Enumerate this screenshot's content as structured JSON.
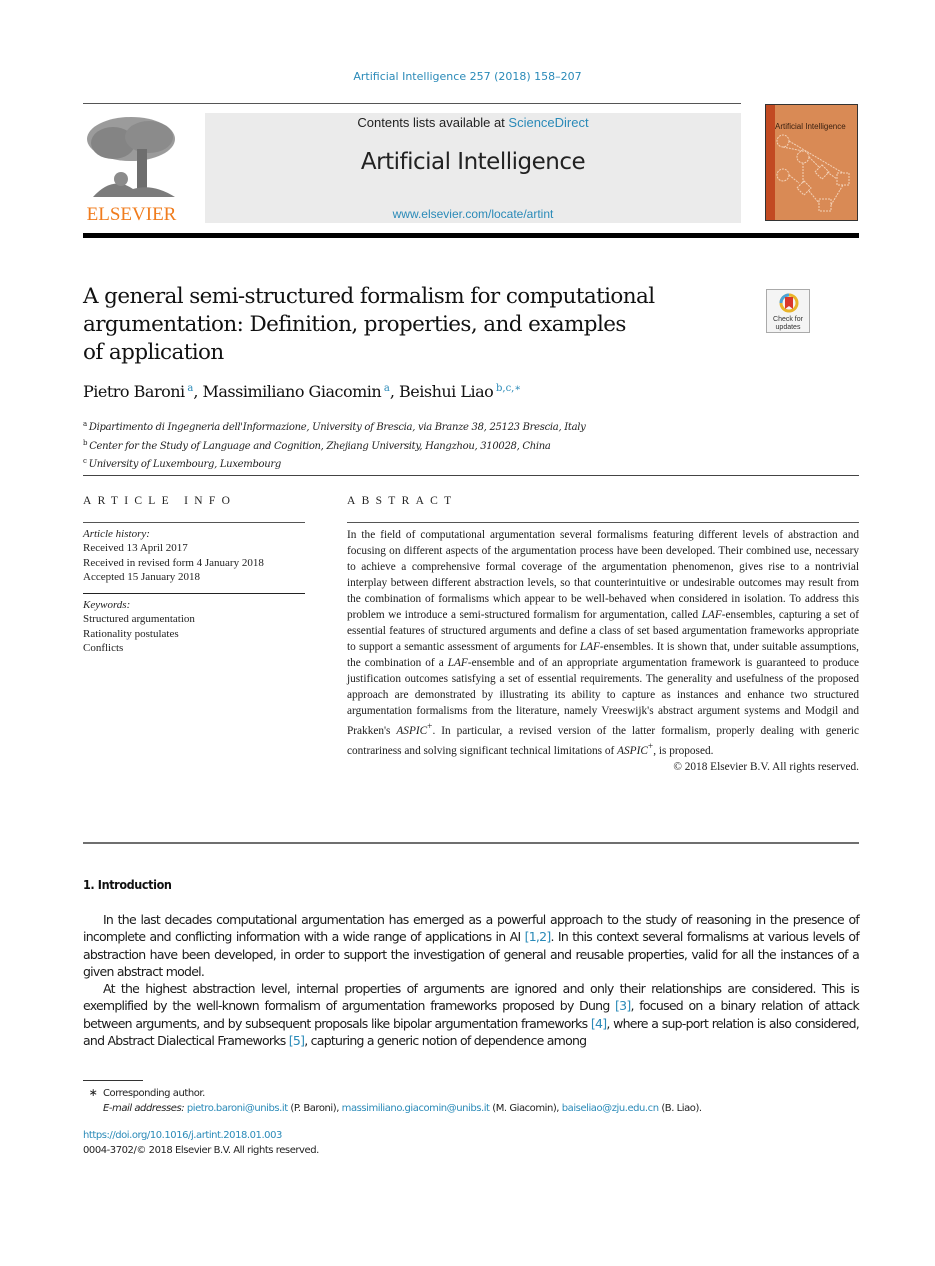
{
  "running_head": "Artificial Intelligence 257 (2018) 158–207",
  "masthead": {
    "publisher": "ELSEVIER",
    "contents_prefix": "Contents lists available at ",
    "contents_link": "ScienceDirect",
    "journal": "Artificial Intelligence",
    "url": "www.elsevier.com/locate/artint",
    "cover_title": "Artificial Intelligence",
    "colors": {
      "link": "#2a8ab8",
      "publisher": "#f07c1d",
      "cover": "#d98a55",
      "cover_strip": "#c24a22"
    }
  },
  "crossmark": {
    "line1": "Check for",
    "line2": "updates"
  },
  "title_lines": [
    "A general semi-structured formalism for computational",
    "argumentation: Definition, properties, and examples",
    "of application"
  ],
  "authors": [
    {
      "name": "Pietro Baroni",
      "sup": "a"
    },
    {
      "name": "Massimiliano Giacomin",
      "sup": "a"
    },
    {
      "name": "Beishui Liao",
      "sup": "b,c,∗"
    }
  ],
  "affiliations": [
    {
      "mark": "a",
      "text": "Dipartimento di Ingegneria dell'Informazione, University of Brescia, via Branze 38, 25123 Brescia, Italy"
    },
    {
      "mark": "b",
      "text": "Center for the Study of Language and Cognition, Zhejiang University, Hangzhou, 310028, China"
    },
    {
      "mark": "c",
      "text": "University of Luxembourg, Luxembourg"
    }
  ],
  "article_info": {
    "heading": "ARTICLE INFO",
    "history_label": "Article history:",
    "history": [
      "Received 13 April 2017",
      "Received in revised form 4 January 2018",
      "Accepted 15 January 2018"
    ],
    "keywords_label": "Keywords:",
    "keywords": [
      "Structured argumentation",
      "Rationality postulates",
      "Conflicts"
    ]
  },
  "abstract": {
    "heading": "ABSTRACT",
    "p1": "In the field of computational argumentation several formalisms featuring different levels of abstraction and focusing on different aspects of the argumentation process have been developed. Their combined use, necessary to achieve a comprehensive formal coverage of the argumentation phenomenon, gives rise to a nontrivial interplay between different abstraction levels, so that counterintuitive or undesirable outcomes may result from the combination of formalisms which appear to be well-behaved when considered in isolation. To address this problem we introduce a semi-structured formalism for argumentation, called ",
    "laf": "LAF",
    "p2": "-ensembles, capturing a set of essential features of structured arguments and define a class of set based argumentation frameworks appropriate to support a semantic assessment of arguments for ",
    "p3": "-ensembles. It is shown that, under suitable assumptions, the combination of a ",
    "p4": "-ensemble and of an appropriate argumentation framework is guaranteed to produce justification outcomes satisfying a set of essential requirements. The generality and usefulness of the proposed approach are demonstrated by illustrating its ability to capture as instances and enhance two structured argumentation formalisms from the literature, namely Vreeswijk's abstract argument systems and Modgil and Prakken's ",
    "aspic": "ASPIC",
    "aspic_sup": "+",
    "p5": ". In particular, a revised version of the latter formalism, properly dealing with generic contrariness and solving significant technical limitations of ",
    "p6": ", is proposed.",
    "copyright": "© 2018 Elsevier B.V. All rights reserved."
  },
  "introduction": {
    "heading": "1. Introduction",
    "para1_a": "In the last decades computational argumentation has emerged as a powerful approach to the study of reasoning in the presence of incomplete and conflicting information with a wide range of applications in AI ",
    "ref_1_2": "[1,2]",
    "para1_b": ". In this context several formalisms at various levels of abstraction have been developed, in order to support the investigation of general and reusable properties, valid for all the instances of a given abstract model.",
    "para2_a": "At the highest abstraction level, internal properties of arguments are ignored and only their relationships are considered. This is exemplified by the well-known formalism of argumentation frameworks proposed by Dung ",
    "ref_3": "[3]",
    "para2_b": ", focused on a binary relation of attack between arguments, and by subsequent proposals like bipolar argumentation frameworks ",
    "ref_4": "[4]",
    "para2_c": ", where a sup-port relation is also considered, and Abstract Dialectical Frameworks ",
    "ref_5": "[5]",
    "para2_d": ", capturing a generic notion of dependence among"
  },
  "footnotes": {
    "star": "∗",
    "corresponding": "Corresponding author.",
    "email_label": "E-mail addresses:",
    "emails": [
      {
        "address": "pietro.baroni@unibs.it",
        "who": " (P. Baroni), "
      },
      {
        "address": "massimiliano.giacomin@unibs.it",
        "who": " (M. Giacomin), "
      },
      {
        "address": "baiseliao@zju.edu.cn",
        "who": " (B. Liao)."
      }
    ],
    "doi": "https://doi.org/10.1016/j.artint.2018.01.003",
    "issn_copyright": "0004-3702/© 2018 Elsevier B.V. All rights reserved."
  }
}
